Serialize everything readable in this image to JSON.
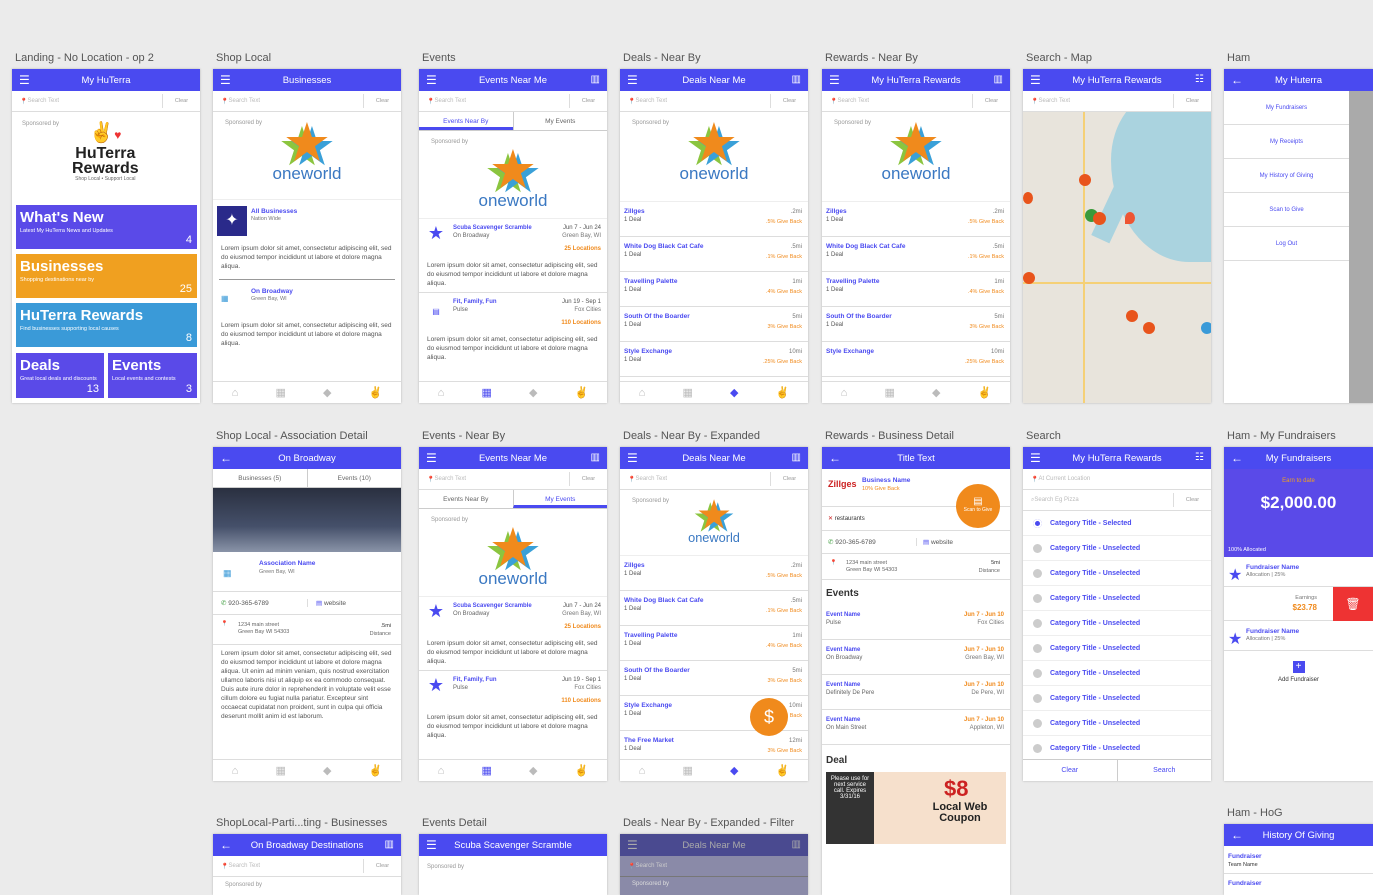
{
  "labels": [
    "Landing - No Location - op 2",
    "Shop Local",
    "Events",
    "Deals - Near By",
    "Rewards - Near By",
    "Search - Map",
    "Ham",
    "Shop Local - Association Detail",
    "Events - Near By",
    "Deals - Near By - Expanded",
    "Rewards - Business Detail",
    "Search",
    "Ham - My Fundraisers",
    "ShopLocal-Parti...ting - Businesses",
    "Events Detail",
    "Deals - Near By - Expanded - Filter",
    "Ham - HoG"
  ],
  "titles": {
    "landing": "My HuTerra",
    "shop": "Businesses",
    "events": "Events Near Me",
    "deals": "Deals Near Me",
    "rewards": "My HuTerra Rewards",
    "map": "My HuTerra Rewards",
    "ham": "My Huterra",
    "assoc": "On Broadway",
    "events2": "Events Near Me",
    "deals2": "Deals Near Me",
    "rdetail": "Title Text",
    "search": "My HuTerra Rewards",
    "fund": "My Fundraisers",
    "partic": "On Broadway Destinations",
    "evdetail": "Scuba Scavenger Scramble",
    "filter": "Deals Near Me",
    "hog": "History Of Giving"
  },
  "search": {
    "placeholder": "Search Text",
    "clear": "Clear",
    "current": "At Current Location",
    "pizza": "Search Eg Pizza"
  },
  "common": {
    "sponsored": "Sponsored by",
    "oneworld": "oneworld",
    "huterra": "HuTerra",
    "rewards_word": "Rewards",
    "tagline": "Shop Local • Support Local"
  },
  "tiles": [
    {
      "title": "What's New",
      "sub": "Latest My HuTerra News and Updates",
      "count": "4",
      "color": "#5a4ae8"
    },
    {
      "title": "Businesses",
      "sub": "Shopping destinations near by",
      "count": "25",
      "color": "#f0a020"
    },
    {
      "title": "HuTerra Rewards",
      "sub": "Find businesses supporting local causes",
      "count": "8",
      "color": "#3a9ad8"
    },
    {
      "title": "Deals",
      "sub": "Great local deals and discounts",
      "count": "13",
      "color": "#5a4ae8"
    },
    {
      "title": "Events",
      "sub": "Local events and contests",
      "count": "3",
      "color": "#5a4ae8"
    }
  ],
  "shop": {
    "all": "All Businesses",
    "nation": "Nation Wide",
    "onb": "On Broadway",
    "gb": "Green Bay, WI"
  },
  "lorem": "Lorem ipsum dolor sit amet, consectetur adipiscing elit, sed do eiusmod tempor incididunt ut labore et dolore magna aliqua.",
  "lorem_long": "Lorem ipsum dolor sit amet, consectetur adipiscing elit, sed do eiusmod tempor incididunt ut labore et dolore magna aliqua. Ut enim ad minim veniam, quis nostrud exercitation ullamco laboris nisi ut aliquip ex ea commodo consequat. Duis aute irure dolor in reprehenderit in voluptate velit esse cillum dolore eu fugiat nulla pariatur. Excepteur sint occaecat cupidatat non proident, sunt in culpa qui officia deserunt mollit anim id est laborum.",
  "tabs": {
    "near": "Events Near By",
    "my": "My Events",
    "biz": "Businesses (5)",
    "ev": "Events (10)"
  },
  "events": [
    {
      "name": "Scuba Scavenger Scramble",
      "sub": "On Broadway",
      "date": "Jun 7 - Jun 24",
      "city": "Green Bay, WI",
      "loc": "25 Locations"
    },
    {
      "name": "Fit, Family, Fun",
      "sub": "Pulse",
      "date": "Jun 19 - Sep 1",
      "city": "Fox Cities",
      "loc": "110 Locations"
    }
  ],
  "deals": [
    {
      "name": "Zillges",
      "sub": "1 Deal",
      "dist": ".2mi",
      "give": ".5% Give Back"
    },
    {
      "name": "White Dog Black Cat Cafe",
      "sub": "1 Deal",
      "dist": ".5mi",
      "give": ".1% Give Back"
    },
    {
      "name": "Travelling Palette",
      "sub": "1 Deal",
      "dist": "1mi",
      "give": ".4% Give Back"
    },
    {
      "name": "South Of the Boarder",
      "sub": "1 Deal",
      "dist": "5mi",
      "give": "3% Give Back"
    },
    {
      "name": "Style Exchange",
      "sub": "1 Deal",
      "dist": "10mi",
      "give": ".25% Give Back"
    },
    {
      "name": "The Free Market",
      "sub": "1 Deal",
      "dist": "12mi",
      "give": "3% Give Back"
    }
  ],
  "ham": [
    "My Fundraisers",
    "My Receipts",
    "My History of Giving",
    "Scan to Give",
    "Log Out"
  ],
  "assoc": {
    "name": "Association Name",
    "city": "Green Bay, WI",
    "phone": "920-365-6789",
    "web": "website",
    "addr": "1234 main street",
    "addr2": "Green Bay WI 54303",
    "dist": ".5mi",
    "distl": "Distance"
  },
  "rdetail": {
    "biz": "Business Name",
    "give": "10% Give Back",
    "scan": "Scan to Give",
    "cat": "restaurants",
    "events_h": "Events",
    "deal_h": "Deal",
    "coupon": "$8",
    "coupon2": "Local Web Coupon",
    "exp": "Please use for next service call. Expires 3/31/16",
    "addr": "1234 main street",
    "addr2": "Green Bay WI 54303",
    "dist": "5mi",
    "distl": "Distance"
  },
  "rev": [
    {
      "n": "Event Name",
      "s": "Pulse",
      "d": "Jun 7 - Jun 10",
      "c": "Fox Cities"
    },
    {
      "n": "Event Name",
      "s": "On Broadway",
      "d": "Jun 7 - Jun 10",
      "c": "Green Bay, WI"
    },
    {
      "n": "Event Name",
      "s": "Definitely De Pere",
      "d": "Jun 7 - Jun 10",
      "c": "De Pere, WI"
    },
    {
      "n": "Event Name",
      "s": "On Main Street",
      "d": "Jun 7 - Jun 10",
      "c": "Appleton, WI"
    }
  ],
  "cats": [
    "Category Title - Selected",
    "Category Title - Unselected",
    "Category Title - Unselected",
    "Category Title - Unselected",
    "Category Title - Unselected",
    "Category Title - Unselected",
    "Category Title - Unselected",
    "Category Title - Unselected",
    "Category Title - Unselected",
    "Category Title - Unselected"
  ],
  "searchbtn": "Search",
  "fund": {
    "earn": "Earn to date",
    "amt": "$2,000.00",
    "alloc": "100% Allocated",
    "fn": "Fundraiser Name",
    "fa": "Allocation | 25%",
    "earnings": "Earnings",
    "earnv": "$23.78",
    "add": "Add Fundraiser"
  },
  "hog": {
    "f": "Fundraiser",
    "team": "Team Name"
  }
}
